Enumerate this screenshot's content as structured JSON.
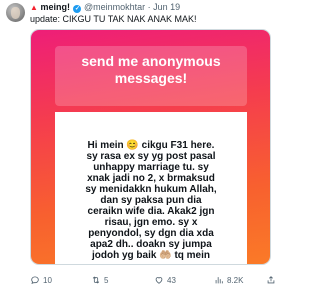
{
  "tweet": {
    "display_name": "meing!",
    "handle_date": "@meinmokhtar · Jun 19",
    "text": "update: CIKGU TU TAK NAK ANAK MAK!"
  },
  "card": {
    "title_line1": "send me anonymous",
    "title_line2": "messages!",
    "message_lines": [
      "Hi mein 😊 cikgu F31 here.",
      "sy rasa ex sy yg post pasal",
      "unhappy marriage tu. sy",
      "xnak jadi no 2, x brmaksud",
      "sy menidakkn hukum Allah,",
      "dan sy paksa pun dia",
      "ceraikn wife dia. Akak2 jgn",
      "risau, jgn emo. sy x",
      "penyondol, sy dgn dia xda",
      "apa2 dh.. doakn sy jumpa",
      "jodoh yg baik 🤲🏼 tq mein"
    ],
    "gradient_colors": [
      "#ee1e78",
      "#f8602f"
    ]
  },
  "actions": {
    "replies": "10",
    "retweets": "5",
    "likes": "43",
    "views": "8.2K"
  }
}
